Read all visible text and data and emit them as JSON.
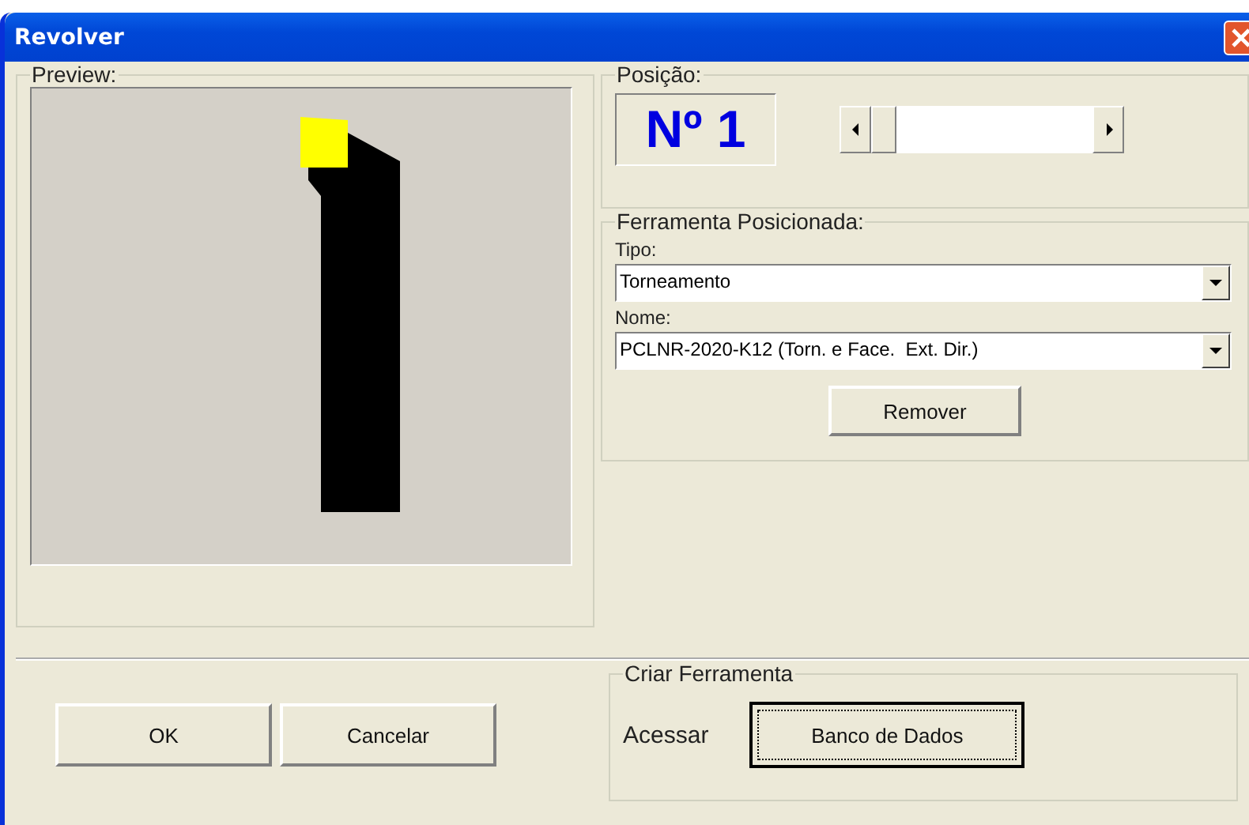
{
  "window": {
    "title": "Revolver"
  },
  "preview": {
    "label": "Preview:"
  },
  "position": {
    "label": "Posição:",
    "number": "Nº 1"
  },
  "tool": {
    "label": "Ferramenta Posicionada:",
    "type_label": "Tipo:",
    "type_value": "Torneamento",
    "name_label": "Nome:",
    "name_value": "PCLNR-2020-K12 (Torn. e Face.  Ext. Dir.)",
    "remove_button": "Remover"
  },
  "buttons": [
    "OK",
    "Cancelar"
  ],
  "create": {
    "label": "Criar Ferramenta",
    "access_label": "Acessar",
    "database_button": "Banco de Dados"
  }
}
